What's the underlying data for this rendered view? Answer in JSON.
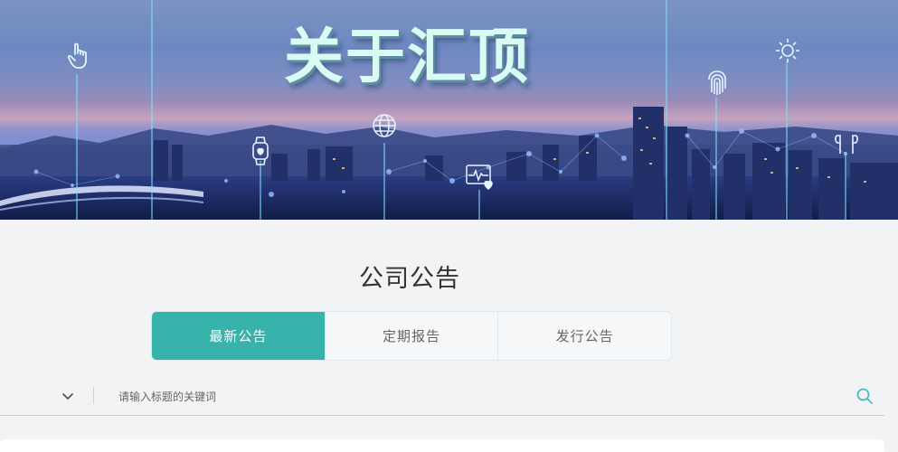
{
  "hero": {
    "title": "关于汇顶",
    "icons": [
      "touch-icon",
      "fingerprint-icon",
      "sun-icon",
      "globe-icon",
      "smartwatch-icon",
      "heart-monitor-icon",
      "earbuds-icon"
    ]
  },
  "section": {
    "title": "公司公告"
  },
  "tabs": [
    {
      "label": "最新公告",
      "active": true
    },
    {
      "label": "定期报告",
      "active": false
    },
    {
      "label": "发行公告",
      "active": false
    }
  ],
  "search": {
    "placeholder": "请输入标题的关键词",
    "value": ""
  },
  "colors": {
    "accent": "#37b3ac",
    "page_bg": "#f1f3f5",
    "search_icon": "#4fb8c8"
  }
}
